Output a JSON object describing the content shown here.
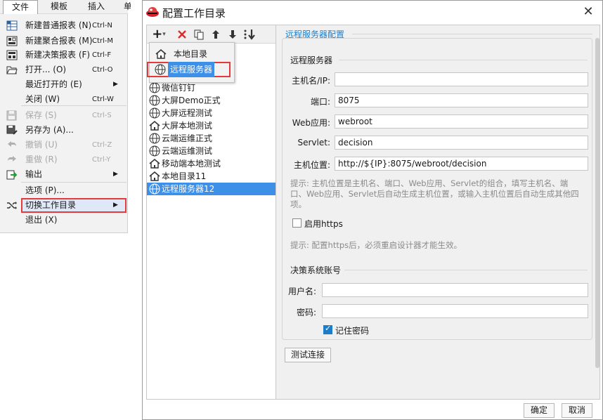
{
  "menubar": {
    "file": "文件",
    "template": "模板",
    "insert": "插入",
    "cut": "单"
  },
  "file_menu": {
    "items": [
      {
        "label": "新建普通报表 (N)",
        "shortcut": "Ctrl-N",
        "icon": "grid-report-icon",
        "disabled": false
      },
      {
        "label": "新建聚合报表 (M)",
        "shortcut": "Ctrl-M",
        "icon": "aggregate-report-icon",
        "disabled": false
      },
      {
        "label": "新建决策报表 (F)",
        "shortcut": "Ctrl-F",
        "icon": "decision-report-icon",
        "disabled": false
      },
      {
        "label": "打开... (O)",
        "shortcut": "Ctrl-O",
        "icon": "folder-open-icon",
        "disabled": false
      },
      {
        "label": "最近打开的 (E)",
        "shortcut": "",
        "icon": "",
        "disabled": false,
        "submenu": true
      },
      {
        "label": "关闭 (W)",
        "shortcut": "Ctrl-W",
        "icon": "",
        "disabled": false
      },
      {
        "label": "保存 (S)",
        "shortcut": "Ctrl-S",
        "icon": "save-icon",
        "disabled": true
      },
      {
        "label": "另存为 (A)...",
        "shortcut": "",
        "icon": "save-as-icon",
        "disabled": false
      },
      {
        "label": "撤销 (U)",
        "shortcut": "Ctrl-Z",
        "icon": "undo-icon",
        "disabled": true
      },
      {
        "label": "重做 (R)",
        "shortcut": "Ctrl-Y",
        "icon": "redo-icon",
        "disabled": true
      },
      {
        "label": "输出",
        "shortcut": "",
        "icon": "export-icon",
        "disabled": false,
        "submenu": true
      },
      {
        "label": "选项 (P)...",
        "shortcut": "",
        "icon": "",
        "disabled": false
      },
      {
        "label": "切换工作目录",
        "shortcut": "",
        "icon": "shuffle-icon",
        "disabled": false,
        "submenu": true,
        "highlighted": true
      },
      {
        "label": "退出 (X)",
        "shortcut": "",
        "icon": "",
        "disabled": false
      }
    ]
  },
  "dialog": {
    "title": "配置工作目录",
    "close": "✕",
    "colors": {
      "accent": "#1e7dc8",
      "selection": "#3d8fe8",
      "highlight": "#e5393b"
    }
  },
  "toolbar": {
    "add": "+",
    "add_arrow": "▾"
  },
  "popup": {
    "items": [
      {
        "label": "本地目录",
        "icon": "home-icon"
      },
      {
        "label": "远程服务器",
        "icon": "globe-icon",
        "highlighted": true
      }
    ]
  },
  "tree": {
    "items": [
      {
        "label": "微信钉钉",
        "icon": "globe-icon"
      },
      {
        "label": "大屏Demo正式",
        "icon": "globe-icon"
      },
      {
        "label": "大屏远程测试",
        "icon": "globe-icon"
      },
      {
        "label": "大屏本地测试",
        "icon": "home-icon"
      },
      {
        "label": "云端运维正式",
        "icon": "globe-icon"
      },
      {
        "label": "云端运维测试",
        "icon": "globe-icon"
      },
      {
        "label": "移动端本地测试",
        "icon": "home-icon"
      },
      {
        "label": "本地目录11",
        "icon": "home-icon"
      },
      {
        "label": "远程服务器12",
        "icon": "globe-icon",
        "selected": true
      }
    ]
  },
  "config": {
    "header": "远程服务器配置",
    "section_remote": "远程服务器",
    "host_label": "主机名/IP:",
    "host_value": "",
    "port_label": "端口:",
    "port_value": "8075",
    "webapp_label": "Web应用:",
    "webapp_value": "webroot",
    "servlet_label": "Servlet:",
    "servlet_value": "decision",
    "location_label": "主机位置:",
    "location_value": "http://${IP}:8075/webroot/decision",
    "hint1_l1": "提示: 主机位置是主机名、端口、Web应用、Servlet的组合，填写主机名、端",
    "hint1_l2": "口、Web应用、Servlet后自动生成主机位置，或输入主机位置后自动生成其他四",
    "hint1_l3": "项。",
    "https_label": "启用https",
    "https_checked": false,
    "hint2": "提示: 配置https后，必须重启设计器才能生效。",
    "section_account": "决策系统账号",
    "user_label": "用户名:",
    "user_value": "",
    "password_label": "密码:",
    "password_value": "",
    "remember_label": "记住密码",
    "remember_checked": true,
    "test_button": "测试连接"
  },
  "buttons": {
    "ok": "确定",
    "cancel": "取消"
  }
}
